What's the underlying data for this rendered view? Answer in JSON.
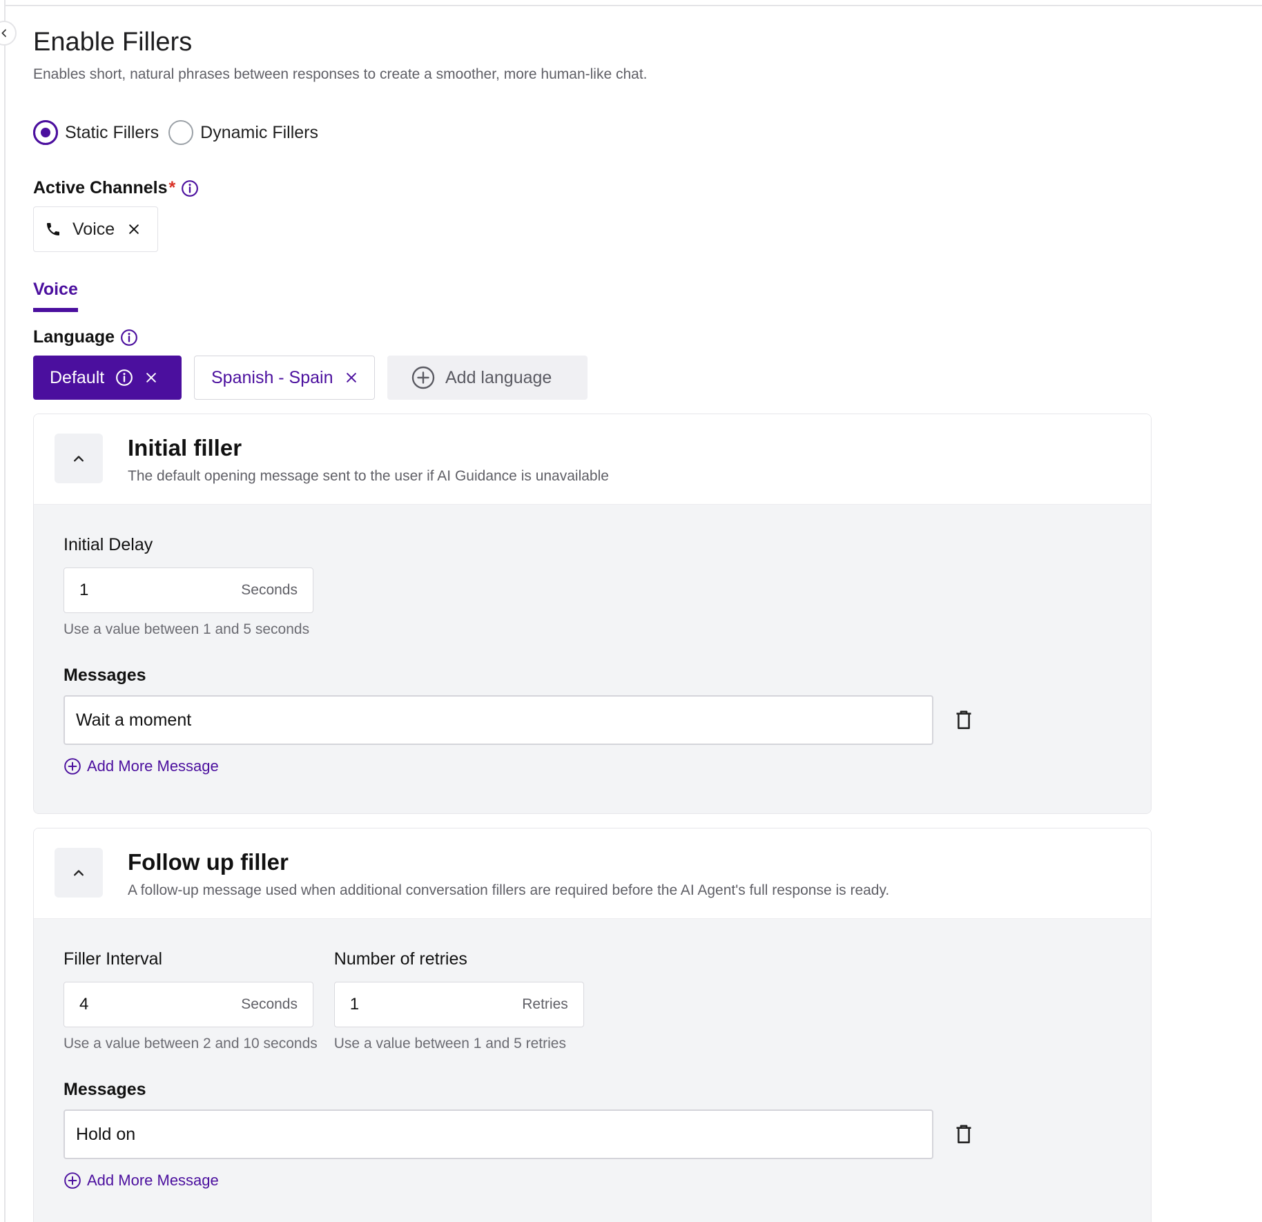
{
  "page": {
    "title": "Enable Fillers",
    "subtitle": "Enables short, natural phrases between responses to create a smoother, more human-like chat."
  },
  "filler_type": {
    "options": [
      {
        "label": "Static Fillers",
        "checked": true
      },
      {
        "label": "Dynamic Fillers",
        "checked": false
      }
    ]
  },
  "channels": {
    "label": "Active Channels",
    "required_mark": "*",
    "chips": [
      {
        "label": "Voice",
        "icon": "phone-icon"
      }
    ]
  },
  "tabs": [
    {
      "label": "Voice",
      "active": true
    }
  ],
  "language": {
    "label": "Language",
    "chips": [
      {
        "label": "Default",
        "active": true
      },
      {
        "label": "Spanish - Spain",
        "active": false
      }
    ],
    "add_label": "Add language"
  },
  "initial_filler": {
    "title": "Initial filler",
    "description": "The default opening message sent to the user if AI Guidance is unavailable",
    "delay_label": "Initial Delay",
    "delay_value": "1",
    "delay_unit": "Seconds",
    "delay_hint": "Use a value between 1 and 5 seconds",
    "messages_label": "Messages",
    "messages": [
      "Wait a moment"
    ],
    "add_more_label": "Add More Message"
  },
  "follow_up_filler": {
    "title": "Follow up filler",
    "description": "A follow-up message used when additional conversation fillers are required before the AI Agent's full response is ready.",
    "interval_label": "Filler Interval",
    "interval_value": "4",
    "interval_unit": "Seconds",
    "interval_hint": "Use a value between 2 and 10 seconds",
    "retries_label": "Number of retries",
    "retries_value": "1",
    "retries_unit": "Retries",
    "retries_hint": "Use a value between 1 and 5 retries",
    "messages_label": "Messages",
    "messages": [
      "Hold on"
    ],
    "add_more_label": "Add More Message"
  },
  "colors": {
    "accent": "#4b0f9e",
    "required": "#d93025",
    "card_body_bg": "#f3f4f6"
  }
}
